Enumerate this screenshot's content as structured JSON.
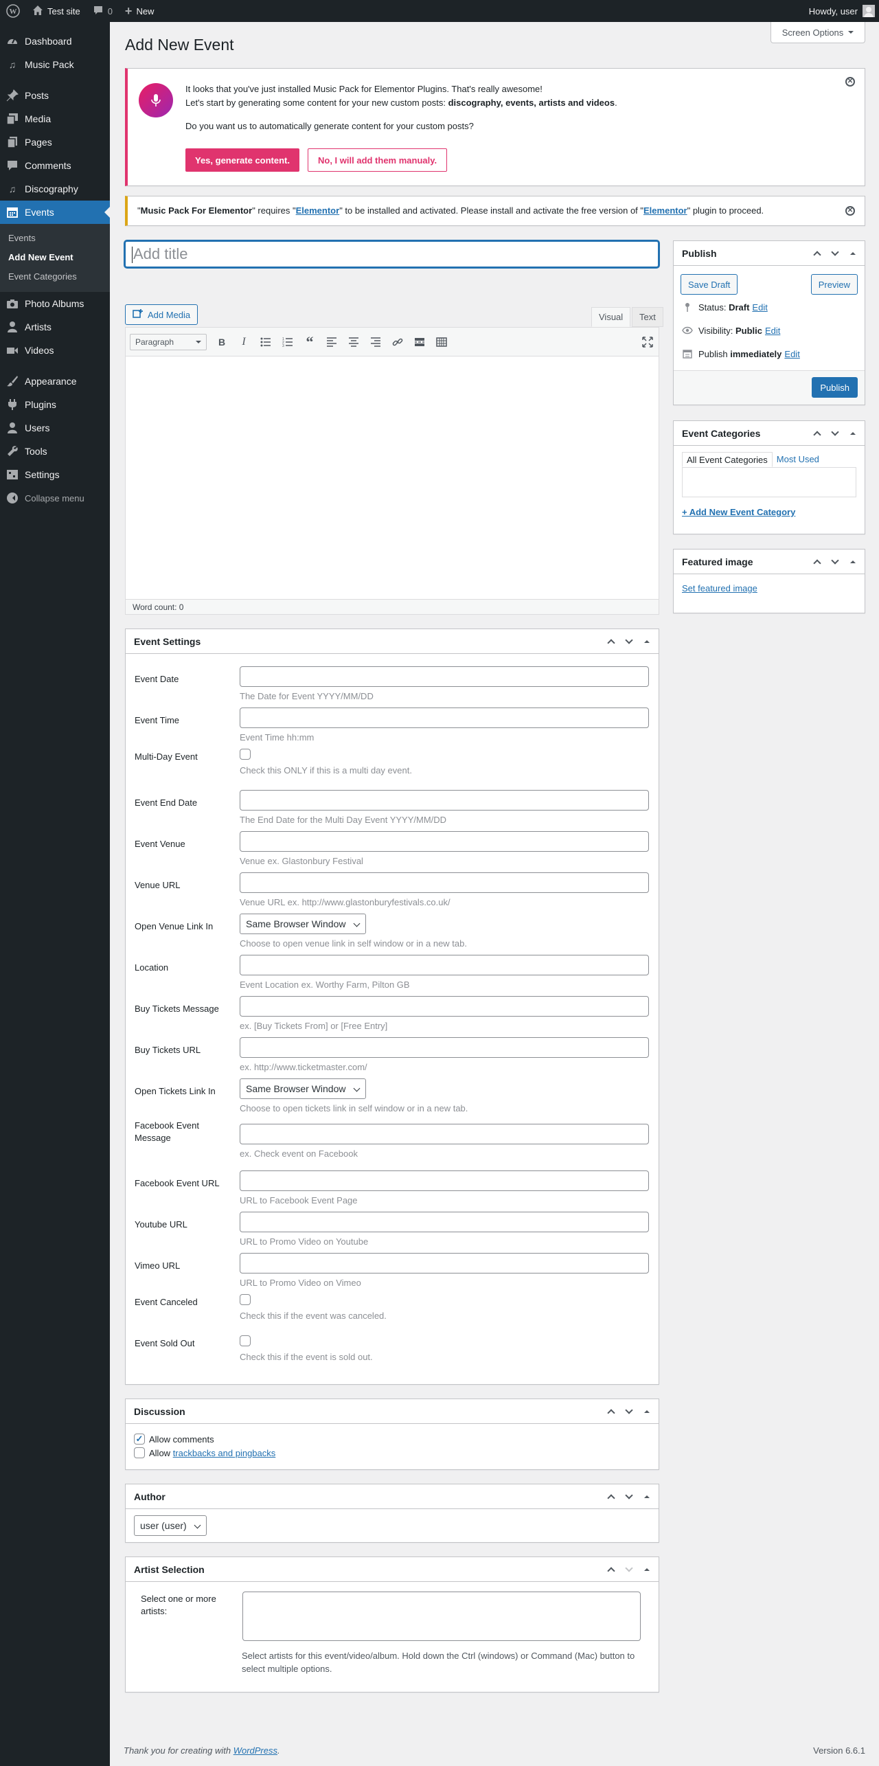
{
  "adminbar": {
    "site_name": "Test site",
    "comments_count": "0",
    "new_label": "New",
    "howdy": "Howdy, user"
  },
  "menu": {
    "dashboard": "Dashboard",
    "music_pack": "Music Pack",
    "posts": "Posts",
    "media": "Media",
    "pages": "Pages",
    "comments": "Comments",
    "discography": "Discography",
    "events": "Events",
    "events_sub": [
      "Events",
      "Add New Event",
      "Event Categories"
    ],
    "photo_albums": "Photo Albums",
    "artists": "Artists",
    "videos": "Videos",
    "appearance": "Appearance",
    "plugins": "Plugins",
    "users": "Users",
    "tools": "Tools",
    "settings": "Settings",
    "collapse": "Collapse menu"
  },
  "page": {
    "title": "Add New Event",
    "screen_options": "Screen Options"
  },
  "notice1": {
    "line1": "It looks that you've just installed Music Pack for Elementor Plugins. That's really awesome!",
    "line2_prefix": "Let's start by generating some content for your new custom posts: ",
    "line2_bold": "discography, events, artists and videos",
    "line2_suffix": ".",
    "question": "Do you want us to automatically generate content for your custom posts?",
    "yes_button": "Yes, generate content.",
    "no_button": "No, I will add them manualy."
  },
  "notice2": {
    "q1": "\"",
    "plugin": "Music Pack For Elementor",
    "requires": "\" requires \"",
    "elementor": "Elementor",
    "mid": "\" to be installed and activated. Please install and activate the free version of \"",
    "elementor2": "Elementor",
    "end": "\" plugin to proceed."
  },
  "editor": {
    "title_placeholder": "Add title",
    "add_media": "Add Media",
    "tab_visual": "Visual",
    "tab_text": "Text",
    "format_select": "Paragraph",
    "word_count": "Word count: 0"
  },
  "event_settings": {
    "title": "Event Settings",
    "rows": [
      {
        "label": "Event Date",
        "desc": "The Date for Event YYYY/MM/DD"
      },
      {
        "label": "Event Time",
        "desc": "Event Time hh:mm"
      },
      {
        "label": "Multi-Day Event",
        "desc": "Check this ONLY if this is a multi day event."
      },
      {
        "label": "Event End Date",
        "desc": "The End Date for the Multi Day Event YYYY/MM/DD"
      },
      {
        "label": "Event Venue",
        "desc": "Venue ex. Glastonbury Festival"
      },
      {
        "label": "Venue URL",
        "desc": "Venue URL ex. http://www.glastonburyfestivals.co.uk/"
      },
      {
        "label": "Open Venue Link In",
        "desc": "Choose to open venue link in self window or in a new tab.",
        "value": "Same Browser Window"
      },
      {
        "label": "Location",
        "desc": "Event Location ex. Worthy Farm, Pilton GB"
      },
      {
        "label": "Buy Tickets Message",
        "desc": "ex. [Buy Tickets From] or [Free Entry]"
      },
      {
        "label": "Buy Tickets URL",
        "desc": "ex. http://www.ticketmaster.com/"
      },
      {
        "label": "Open Tickets Link In",
        "desc": "Choose to open tickets link in self window or in a new tab.",
        "value": "Same Browser Window"
      },
      {
        "label": "Facebook Event Message",
        "desc": "ex. Check event on Facebook"
      },
      {
        "label": "Facebook Event URL",
        "desc": "URL to Facebook Event Page"
      },
      {
        "label": "Youtube URL",
        "desc": "URL to Promo Video on Youtube"
      },
      {
        "label": "Vimeo URL",
        "desc": "URL to Promo Video on Vimeo"
      },
      {
        "label": "Event Canceled",
        "desc": "Check this if the event was canceled."
      },
      {
        "label": "Event Sold Out",
        "desc": "Check this if the event is sold out."
      }
    ]
  },
  "discussion": {
    "title": "Discussion",
    "allow_comments": "Allow comments",
    "allow_prefix": "Allow ",
    "trackbacks": "trackbacks and pingbacks"
  },
  "author": {
    "title": "Author",
    "value": "user (user)"
  },
  "artist_selection": {
    "title": "Artist Selection",
    "label": "Select one or more artists:",
    "desc": "Select artists for this event/video/album. Hold down the Ctrl (windows) or Command (Mac) button to select multiple options."
  },
  "publish": {
    "title": "Publish",
    "save_draft": "Save Draft",
    "preview": "Preview",
    "status_label": "Status: ",
    "status_value": "Draft",
    "visibility_label": "Visibility: ",
    "visibility_value": "Public",
    "publish_label": "Publish ",
    "publish_value": "immediately",
    "edit": "Edit",
    "publish_button": "Publish"
  },
  "event_categories": {
    "title": "Event Categories",
    "tab_all": "All Event Categories",
    "tab_most_used": "Most Used",
    "add_new": "+ Add New Event Category"
  },
  "featured_image": {
    "title": "Featured image",
    "set_link": "Set featured image"
  },
  "footer": {
    "thanks": "Thank you for creating with ",
    "wordpress": "WordPress",
    "period": ".",
    "version": "Version 6.6.1"
  }
}
